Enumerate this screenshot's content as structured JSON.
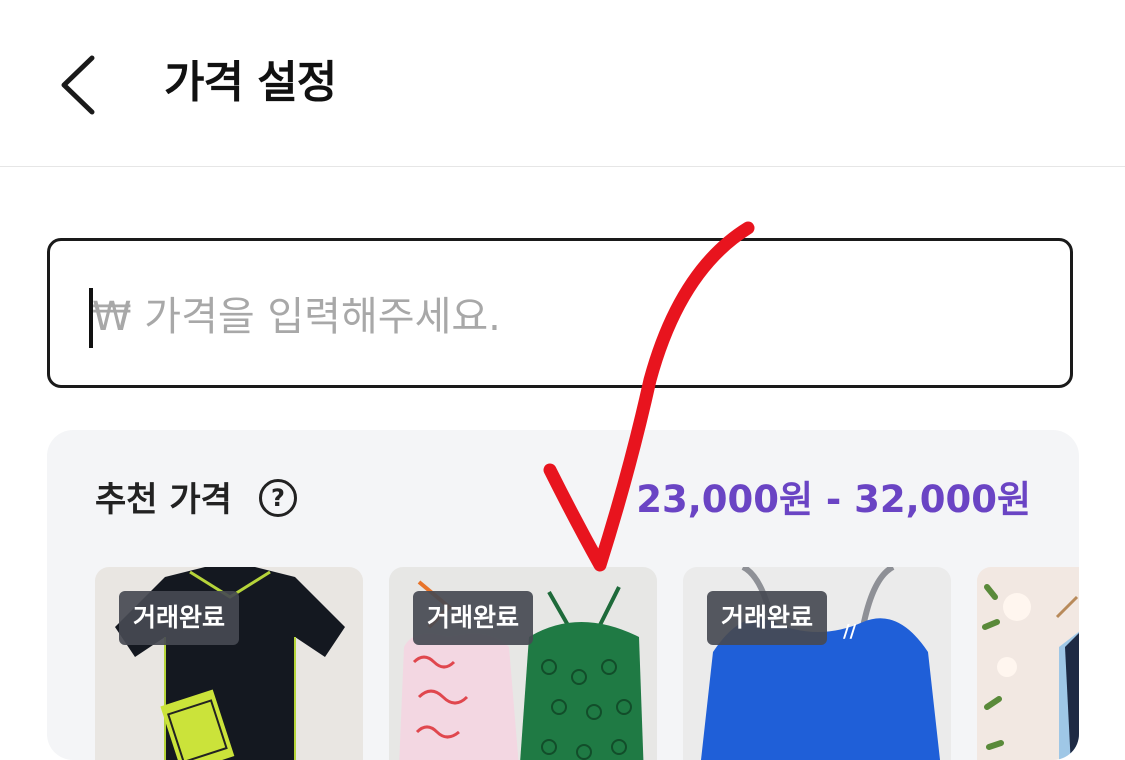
{
  "header": {
    "title": "가격 설정"
  },
  "price_input": {
    "placeholder": "₩ 가격을 입력해주세요.",
    "value": ""
  },
  "recommendation": {
    "title": "추천 가격",
    "help_icon": "question-circle-icon",
    "range": "23,000원 - 32,000원",
    "accent_color": "#6a44c4",
    "items": [
      {
        "badge": "거래완료"
      },
      {
        "badge": "거래완료"
      },
      {
        "badge": "거래완료"
      },
      {
        "badge": ""
      }
    ]
  },
  "annotation": {
    "color": "#e8141e"
  }
}
